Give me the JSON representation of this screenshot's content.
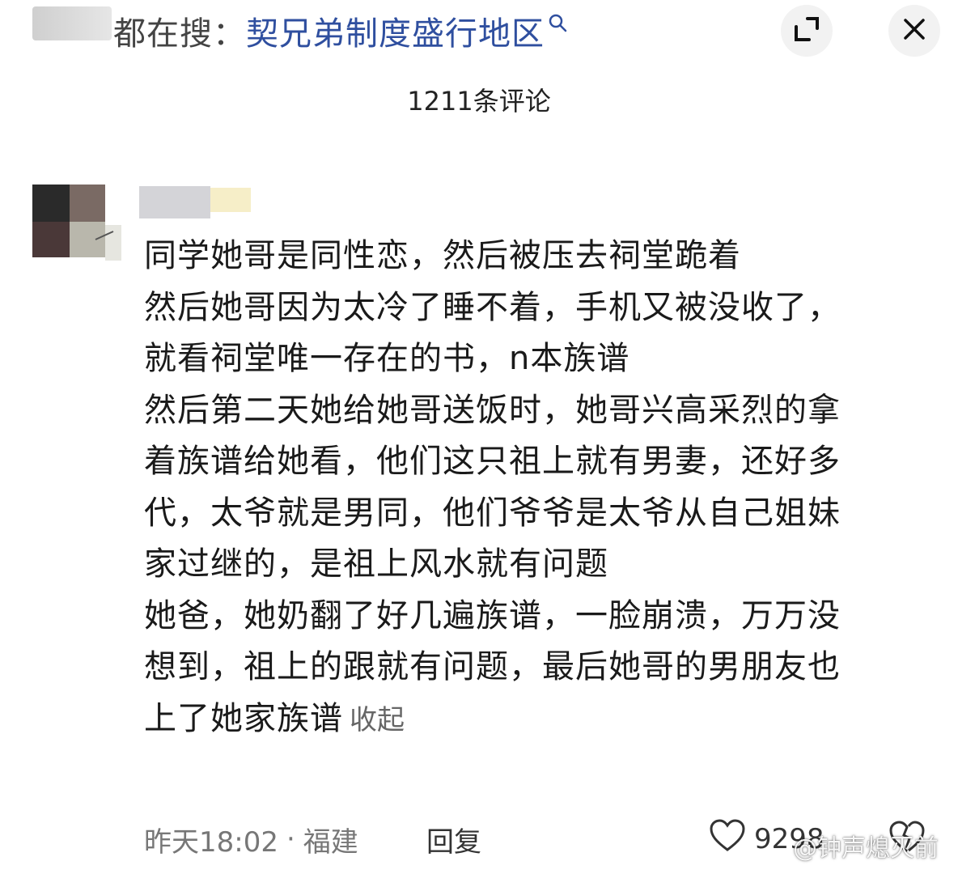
{
  "header": {
    "search_prefix": "都在搜：",
    "search_term": "契兄弟制度盛行地区",
    "search_icon": "search-icon",
    "expand_icon": "expand-icon",
    "close_icon": "close-icon"
  },
  "comments_header": {
    "count_label": "1211条评论"
  },
  "comment": {
    "lines": [
      "同学她哥是同性恋，然后被压去祠堂跪着",
      "然后她哥因为太冷了睡不着，手机又被没收了，",
      "就看祠堂唯一存在的书，n本族谱",
      "然后第二天她给她哥送饭时，她哥兴高采烈的拿",
      "着族谱给她看，他们这只祖上就有男妻，还好多",
      "代，太爷就是男同，他们爷爷是太爷从自己姐妹",
      "家过继的，是祖上风水就有问题",
      "她爸，她奶翻了好几遍族谱，一脸崩溃，万万没",
      "想到，祖上的跟就有问题，最后她哥的男朋友也",
      "上了她家族谱"
    ],
    "collapse_label": "收起",
    "time": "昨天18:02",
    "separator": "·",
    "location": "福建",
    "reply_label": "回复",
    "like_count": "9298"
  },
  "watermark": "@钟声熄灭前",
  "colors": {
    "search_term": "#2f4f9f",
    "text": "#1a1a1a",
    "meta": "#777777",
    "button_bg": "#f2f2f2"
  }
}
